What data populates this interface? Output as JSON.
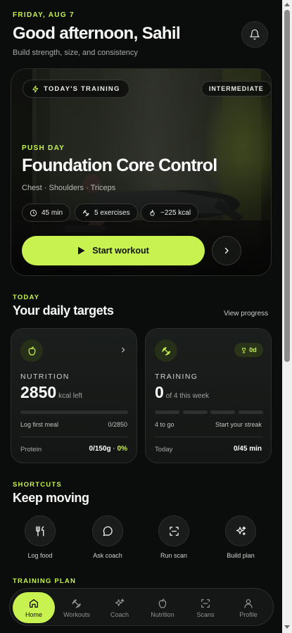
{
  "header": {
    "date": "FRIDAY, AUG 7",
    "greeting": "Good afternoon, Sahil",
    "subtitle": "Build strength, size, and consistency",
    "bell_icon": "bell-icon"
  },
  "hero": {
    "tag": "TODAY'S TRAINING",
    "level": "INTERMEDIATE",
    "category": "PUSH DAY",
    "title": "Foundation Core Control",
    "muscles": "Chest · Shoulders · Triceps",
    "stats": {
      "duration": "45 min",
      "exercises": "5 exercises",
      "calories": "~225 kcal"
    },
    "start_label": "Start workout"
  },
  "targets": {
    "eyebrow": "TODAY",
    "title": "Your daily targets",
    "view_progress": "View progress",
    "nutrition": {
      "label": "NUTRITION",
      "value": "2850",
      "unit": "kcal left",
      "progress": 0,
      "hint_left": "Log first meal",
      "hint_right": "0/2850",
      "foot_label": "Protein",
      "foot_value": "0/150g",
      "foot_sep": " · ",
      "foot_pct": "0%"
    },
    "training": {
      "label": "TRAINING",
      "value": "0",
      "unit": "of 4 this week",
      "streak": "0d",
      "sessions_done": 0,
      "sessions_total": 4,
      "hint_left": "4 to go",
      "hint_right": "Start your streak",
      "foot_label": "Today",
      "foot_value": "0/45 min"
    }
  },
  "shortcuts": {
    "eyebrow": "SHORTCUTS",
    "title": "Keep moving",
    "items": [
      {
        "label": "Log food",
        "icon": "utensils-icon"
      },
      {
        "label": "Ask coach",
        "icon": "chat-bubble-icon"
      },
      {
        "label": "Run scan",
        "icon": "scan-icon"
      },
      {
        "label": "Build plan",
        "icon": "sparkles-icon"
      }
    ]
  },
  "plan": {
    "eyebrow": "TRAINING PLAN"
  },
  "nav": {
    "items": [
      {
        "label": "Home",
        "icon": "home-icon",
        "active": true
      },
      {
        "label": "Workouts",
        "icon": "dumbbell-icon",
        "active": false
      },
      {
        "label": "Coach",
        "icon": "sparkles-icon",
        "active": false
      },
      {
        "label": "Nutrition",
        "icon": "apple-icon",
        "active": false
      },
      {
        "label": "Scans",
        "icon": "scan-icon",
        "active": false
      },
      {
        "label": "Profile",
        "icon": "user-icon",
        "active": false
      }
    ]
  },
  "colors": {
    "accent": "#c6f24e",
    "background": "#0b0c0c",
    "card": "#191b1a"
  }
}
